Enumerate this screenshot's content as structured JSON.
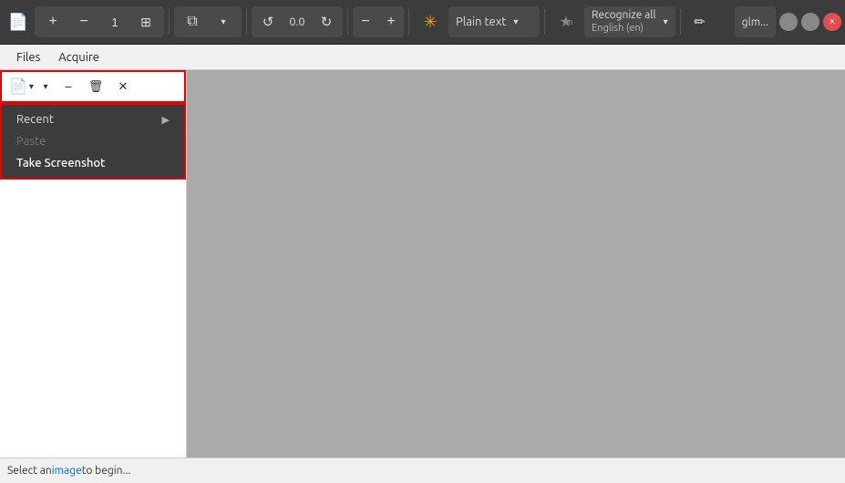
{
  "toolbar": {
    "open_icon": "📂",
    "new_icon": "+",
    "minus_icon": "−",
    "page_icon": "1",
    "grid_icon": "⊞",
    "layers_icon": "⧉",
    "chevron_icon": "▾",
    "rotate_left_icon": "↺",
    "angle_value": "0.0",
    "rotate_right_icon": "↻",
    "zoom_out_icon": "−",
    "zoom_in_icon": "+",
    "ocr_star_icon": "✳",
    "plain_text_label": "Plain text",
    "plain_text_arrow": "▾",
    "rec_star_icon": "★",
    "recognize_label": "Recognize all",
    "recognize_lang": "English (en)",
    "recognize_arrow": "▾",
    "pencil_icon": "✏",
    "user_label": "glm...",
    "window_icon1": "●",
    "window_icon2": "●",
    "close_icon": "×"
  },
  "menubar": {
    "files_label": "Files",
    "acquire_label": "Acquire"
  },
  "panel_toolbar": {
    "open_icon": "📄",
    "minus_icon": "−",
    "trash_icon": "🗑",
    "x_icon": "✕"
  },
  "dropdown": {
    "recent_label": "Recent",
    "paste_label": "Paste",
    "screenshot_label": "Take Screenshot"
  },
  "statusbar": {
    "text_prefix": "Select an ",
    "text_link": "image",
    "text_suffix": " to begin..."
  }
}
